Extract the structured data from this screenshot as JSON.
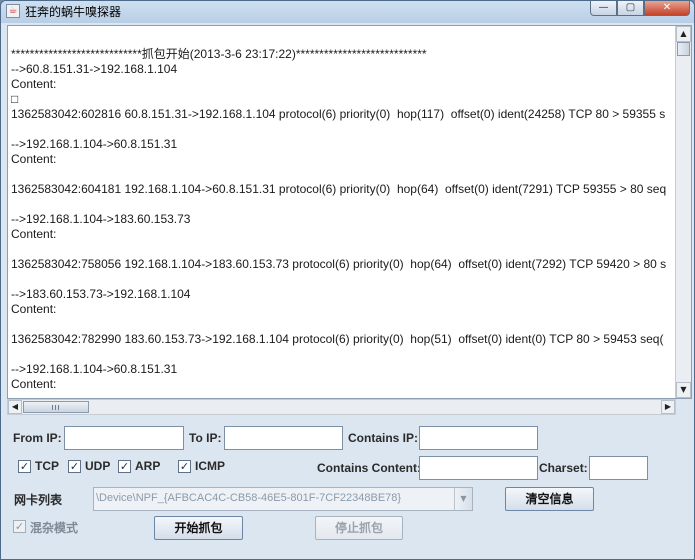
{
  "window": {
    "title": "狂奔的蜗牛嗅探器",
    "minimize": "—",
    "maximize": "▢",
    "close": "✕"
  },
  "log": {
    "lines": [
      "****************************抓包开始(2013-3-6 23:17:22)****************************",
      "-->60.8.151.31->192.168.1.104",
      "Content:",
      "□",
      "1362583042:602816 60.8.151.31->192.168.1.104 protocol(6) priority(0)  hop(117)  offset(0) ident(24258) TCP 80 > 59355 s",
      "",
      "-->192.168.1.104->60.8.151.31",
      "Content:",
      "",
      "1362583042:604181 192.168.1.104->60.8.151.31 protocol(6) priority(0)  hop(64)  offset(0) ident(7291) TCP 59355 > 80 seq",
      "",
      "-->192.168.1.104->183.60.153.73",
      "Content:",
      "",
      "1362583042:758056 192.168.1.104->183.60.153.73 protocol(6) priority(0)  hop(64)  offset(0) ident(7292) TCP 59420 > 80 s",
      "",
      "-->183.60.153.73->192.168.1.104",
      "Content:",
      "",
      "1362583042:782990 183.60.153.73->192.168.1.104 protocol(6) priority(0)  hop(51)  offset(0) ident(0) TCP 80 > 59453 seq(",
      "",
      "-->192.168.1.104->60.8.151.31",
      "Content:"
    ]
  },
  "filters": {
    "from_ip_label": "From IP:",
    "from_ip_value": "",
    "to_ip_label": "To IP:",
    "to_ip_value": "",
    "contains_ip_label": "Contains IP:",
    "contains_ip_value": "",
    "contains_content_label": "Contains Content:",
    "contains_content_value": "",
    "charset_label": "Charset:",
    "charset_value": ""
  },
  "protocols": [
    {
      "label": "TCP",
      "checked": true
    },
    {
      "label": "UDP",
      "checked": true
    },
    {
      "label": "ARP",
      "checked": true
    },
    {
      "label": "ICMP",
      "checked": true
    }
  ],
  "adapter": {
    "label": "网卡列表",
    "selected": "\\Device\\NPF_{AFBCAC4C-CB58-46E5-801F-7CF22348BE78}"
  },
  "buttons": {
    "clear": "清空信息",
    "start": "开始抓包",
    "stop": "停止抓包"
  },
  "promiscuous": {
    "label": "混杂模式",
    "checked": true
  },
  "check_glyph": "✓",
  "scroll": {
    "up": "▲",
    "down": "▼",
    "left": "◀",
    "right": "▶"
  }
}
